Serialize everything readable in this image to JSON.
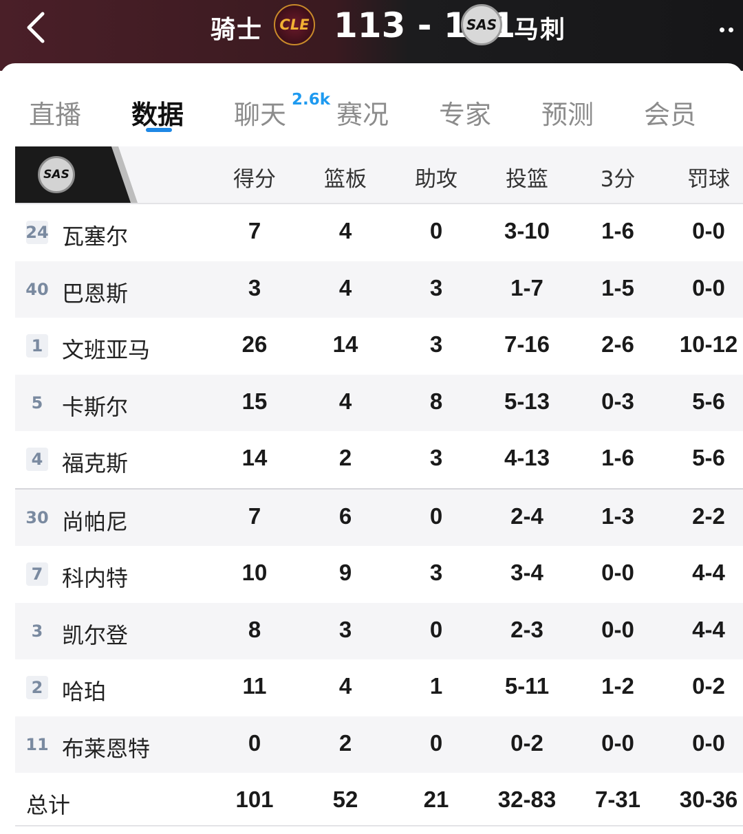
{
  "header": {
    "home_team": "骑士",
    "home_logo_text": "CLE",
    "score": "113 - 101",
    "away_logo_text": "SAS",
    "away_team": "马刺"
  },
  "tabs": [
    {
      "label": "直播"
    },
    {
      "label": "数据"
    },
    {
      "label": "聊天"
    },
    {
      "label": "赛况"
    },
    {
      "label": "专家"
    },
    {
      "label": "预测"
    },
    {
      "label": "会员"
    }
  ],
  "chat_badge": "2.6k",
  "table": {
    "team_logo_text": "SAS",
    "columns": [
      "得分",
      "篮板",
      "助攻",
      "投篮",
      "3分",
      "罚球"
    ],
    "players": [
      {
        "number": "24",
        "name": "瓦塞尔",
        "stats": [
          "7",
          "4",
          "0",
          "3-10",
          "1-6",
          "0-0"
        ]
      },
      {
        "number": "40",
        "name": "巴恩斯",
        "stats": [
          "3",
          "4",
          "3",
          "1-7",
          "1-5",
          "0-0"
        ]
      },
      {
        "number": "1",
        "name": "文班亚马",
        "stats": [
          "26",
          "14",
          "3",
          "7-16",
          "2-6",
          "10-12"
        ]
      },
      {
        "number": "5",
        "name": "卡斯尔",
        "stats": [
          "15",
          "4",
          "8",
          "5-13",
          "0-3",
          "5-6"
        ]
      },
      {
        "number": "4",
        "name": "福克斯",
        "stats": [
          "14",
          "2",
          "3",
          "4-13",
          "1-6",
          "5-6"
        ]
      },
      {
        "number": "30",
        "name": "尚帕尼",
        "stats": [
          "7",
          "6",
          "0",
          "2-4",
          "1-3",
          "2-2"
        ]
      },
      {
        "number": "7",
        "name": "科内特",
        "stats": [
          "10",
          "9",
          "3",
          "3-4",
          "0-0",
          "4-4"
        ]
      },
      {
        "number": "3",
        "name": "凯尔登",
        "stats": [
          "8",
          "3",
          "0",
          "2-3",
          "0-0",
          "4-4"
        ]
      },
      {
        "number": "2",
        "name": "哈珀",
        "stats": [
          "11",
          "4",
          "1",
          "5-11",
          "1-2",
          "0-2"
        ]
      },
      {
        "number": "11",
        "name": "布莱恩特",
        "stats": [
          "0",
          "2",
          "0",
          "0-2",
          "0-0",
          "0-0"
        ]
      }
    ],
    "total": {
      "label": "总计",
      "stats": [
        "101",
        "52",
        "21",
        "32-83",
        "7-31",
        "30-36"
      ]
    }
  }
}
